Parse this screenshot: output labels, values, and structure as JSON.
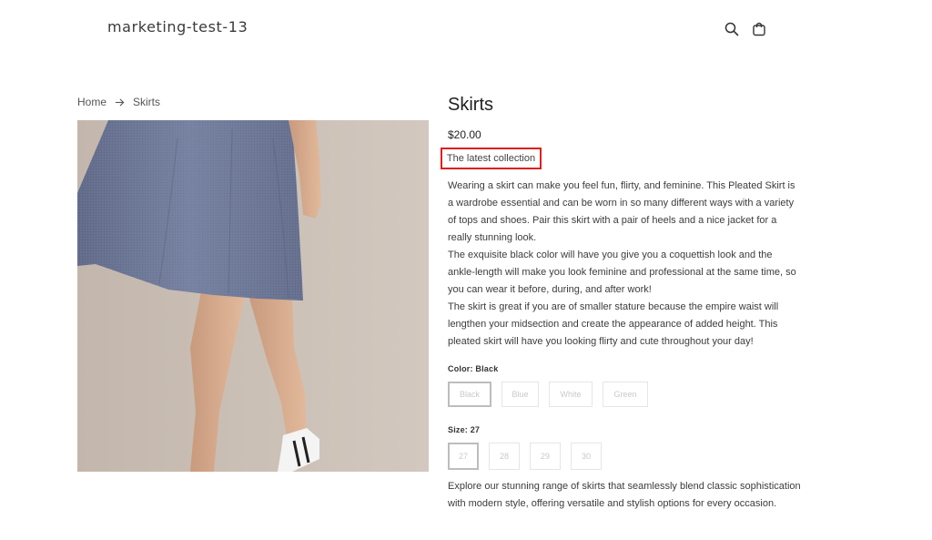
{
  "header": {
    "brand": "marketing-test-13",
    "icons": [
      "search-icon",
      "cart-icon"
    ]
  },
  "breadcrumb": {
    "home": "Home",
    "current": "Skirts"
  },
  "product": {
    "title": "Skirts",
    "price": "$20.00",
    "tagline": "The latest collection",
    "description": [
      "Wearing a skirt can make you feel fun, flirty, and feminine. This Pleated Skirt is a wardrobe essential and can be worn in so many different ways with a variety of tops and shoes. Pair this skirt with a pair of heels and a nice jacket for a really stunning look.",
      "The exquisite black color will have you give you a coquettish look and the ankle-length will make you look feminine and professional at the same time, so you can wear it before, during, and after work!",
      "The skirt is great if you are of smaller stature because the empire waist will lengthen your midsection and create the appearance of added height. This pleated skirt will have you looking flirty and cute throughout your day!"
    ],
    "color": {
      "label": "Color: Black",
      "options": [
        "Black",
        "Blue",
        "White",
        "Green"
      ],
      "selected": "Black"
    },
    "size": {
      "label": "Size: 27",
      "options": [
        "27",
        "28",
        "29",
        "30"
      ],
      "selected": "27"
    },
    "footer_text": "Explore our stunning range of skirts that seamlessly blend classic sophistication with modern style, offering versatile and stylish options for every occasion."
  },
  "colors": {
    "highlight_border": "#e01e1e",
    "skirt": "#6f7997",
    "background_photo": "#c9beb4"
  }
}
